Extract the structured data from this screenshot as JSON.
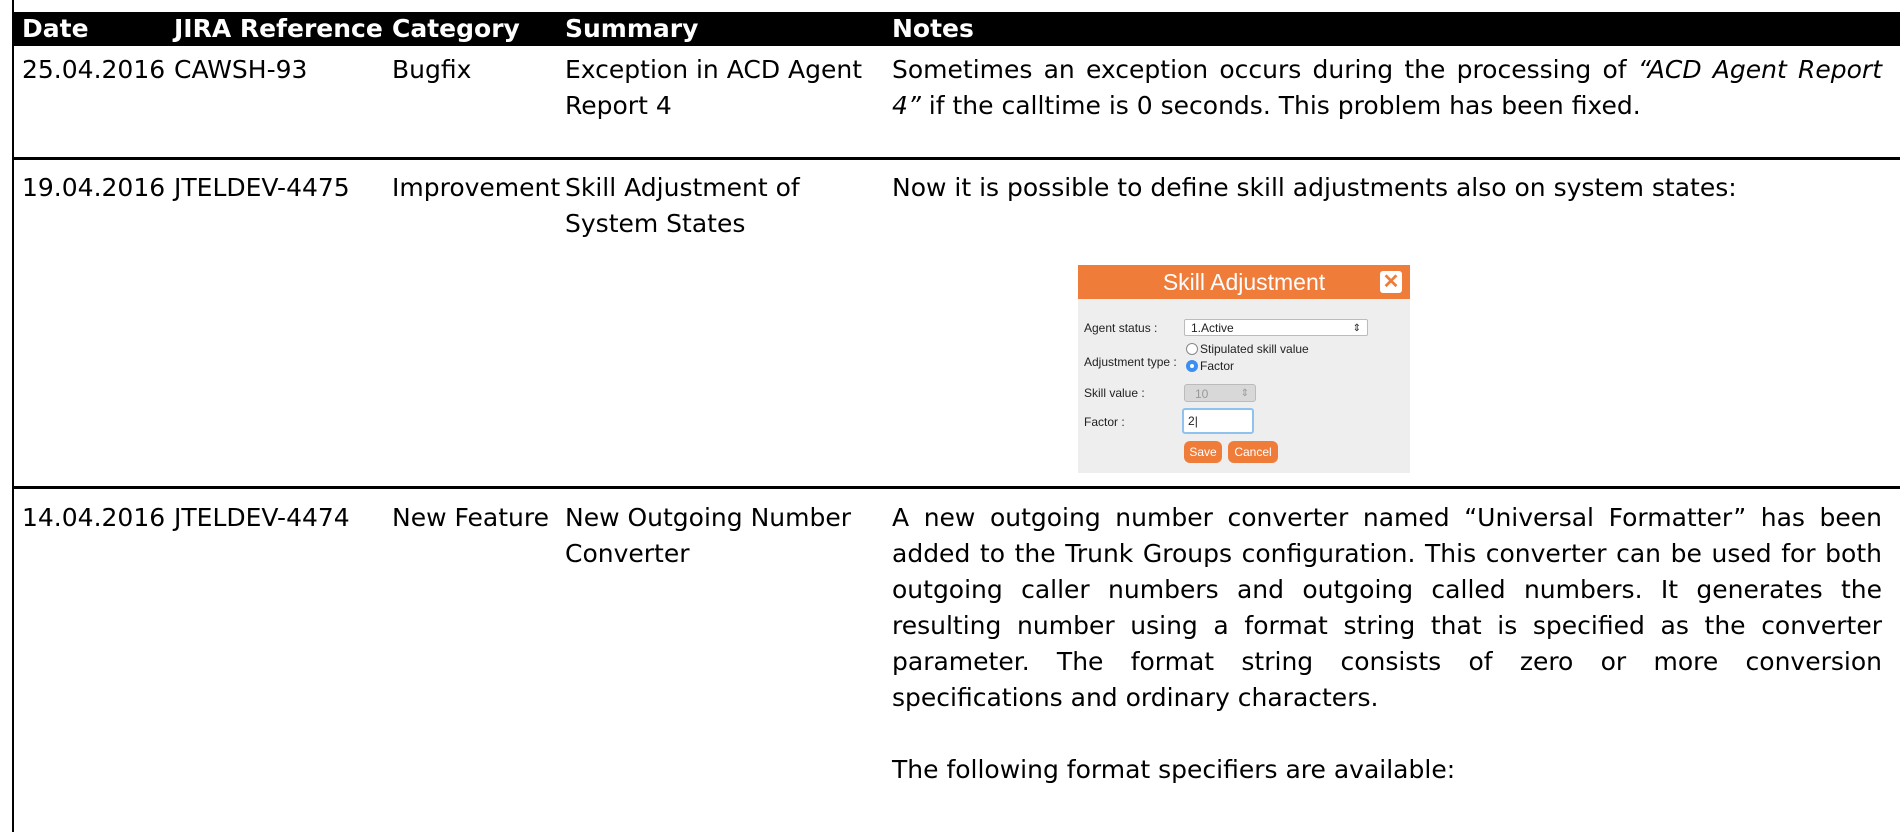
{
  "headers": {
    "date": "Date",
    "jira": "JIRA Reference",
    "category": "Category",
    "summary": "Summary",
    "notes": "Notes"
  },
  "rows": [
    {
      "date": "25.04.2016",
      "jira": "CAWSH-93",
      "category": "Bugfix",
      "summary": "Exception in ACD Agent Report 4",
      "notes_pre": "Sometimes an exception occurs during the processing of ",
      "notes_italic": "“ACD Agent Report 4”",
      "notes_post": " if the calltime is 0 seconds. This problem has been fixed."
    },
    {
      "date": "19.04.2016",
      "jira": "JTELDEV-4475",
      "category": "Improvement",
      "summary": "Skill Adjustment of System States",
      "notes": "Now it is possible to define skill adjustments also on system states:"
    },
    {
      "date": "14.04.2016",
      "jira": "JTELDEV-4474",
      "category": "New Feature",
      "summary": "New Outgoing Number Converter",
      "notes": "A new outgoing number converter named “Universal Formatter” has been added to the Trunk Groups configuration. This converter can be used for both outgoing caller numbers and outgoing called numbers. It generates the resulting number using a format string that is specified as the converter parameter. The format string consists of zero or more conversion specifications and ordinary characters.",
      "notes2": "The following format specifiers are available:"
    }
  ],
  "dialog": {
    "title": "Skill Adjustment",
    "close_icon": "close-icon",
    "agent_status_label": "Agent status :",
    "agent_status_value": "1.Active",
    "adjustment_type_label": "Adjustment type :",
    "option_stipulated": "Stipulated skill value",
    "option_factor": "Factor",
    "selected_option": "Factor",
    "skill_value_label": "Skill value :",
    "skill_value": "10",
    "factor_label": "Factor :",
    "factor_value": "2",
    "save_label": "Save",
    "cancel_label": "Cancel",
    "accent_color": "#f07c3a"
  }
}
